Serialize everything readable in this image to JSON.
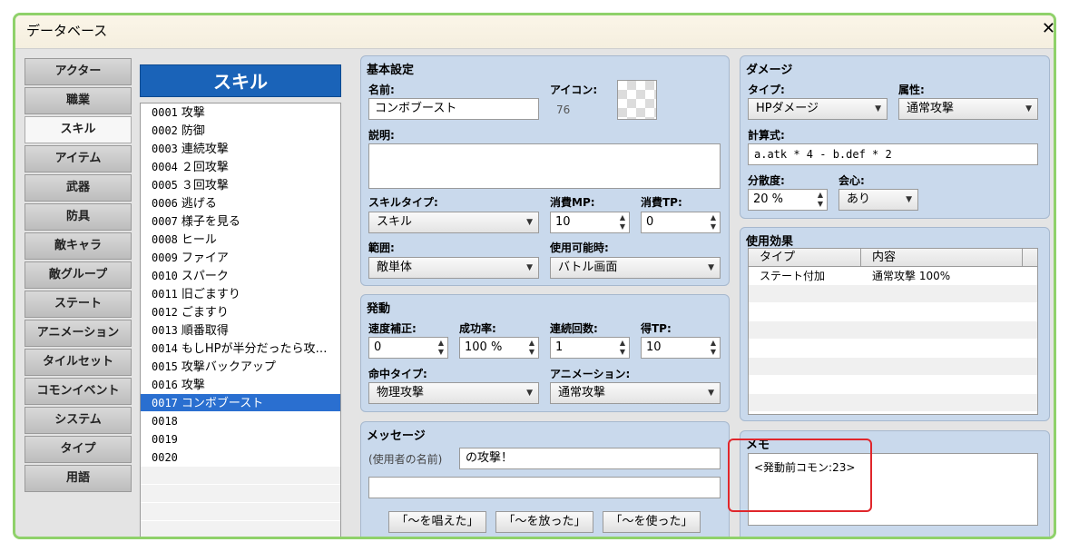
{
  "window": {
    "title": "データベース",
    "close": "✕"
  },
  "categories": [
    "アクター",
    "職業",
    "スキル",
    "アイテム",
    "武器",
    "防具",
    "敵キャラ",
    "敵グループ",
    "ステート",
    "アニメーション",
    "タイルセット",
    "コモンイベント",
    "システム",
    "タイプ",
    "用語"
  ],
  "active_category": "スキル",
  "skill_list": {
    "header": "スキル",
    "items": [
      {
        "num": "0001",
        "name": "攻撃"
      },
      {
        "num": "0002",
        "name": "防御"
      },
      {
        "num": "0003",
        "name": "連続攻撃"
      },
      {
        "num": "0004",
        "name": "２回攻撃"
      },
      {
        "num": "0005",
        "name": "３回攻撃"
      },
      {
        "num": "0006",
        "name": "逃げる"
      },
      {
        "num": "0007",
        "name": "様子を見る"
      },
      {
        "num": "0008",
        "name": "ヒール"
      },
      {
        "num": "0009",
        "name": "ファイア"
      },
      {
        "num": "0010",
        "name": "スパーク"
      },
      {
        "num": "0011",
        "name": "旧ごますり"
      },
      {
        "num": "0012",
        "name": "ごますり"
      },
      {
        "num": "0013",
        "name": "順番取得"
      },
      {
        "num": "0014",
        "name": "もしHPが半分だったら攻…"
      },
      {
        "num": "0015",
        "name": "攻撃バックアップ"
      },
      {
        "num": "0016",
        "name": "攻撃"
      },
      {
        "num": "0017",
        "name": "コンボブースト"
      },
      {
        "num": "0018",
        "name": ""
      },
      {
        "num": "0019",
        "name": ""
      },
      {
        "num": "0020",
        "name": ""
      }
    ],
    "selected": "0017"
  },
  "basic": {
    "title": "基本設定",
    "name_label": "名前:",
    "name_value": "コンボブースト",
    "icon_label": "アイコン:",
    "icon_index": "76",
    "desc_label": "説明:",
    "desc_value": "",
    "skilltype_label": "スキルタイプ:",
    "skilltype_value": "スキル",
    "mp_label": "消費MP:",
    "mp_value": "10",
    "tp_label": "消費TP:",
    "tp_value": "0",
    "scope_label": "範囲:",
    "scope_value": "敵単体",
    "occasion_label": "使用可能時:",
    "occasion_value": "バトル画面"
  },
  "invocation": {
    "title": "発動",
    "speed_label": "速度補正:",
    "speed_value": "0",
    "success_label": "成功率:",
    "success_value": "100 %",
    "repeat_label": "連続回数:",
    "repeat_value": "1",
    "tpgain_label": "得TP:",
    "tpgain_value": "10",
    "hittype_label": "命中タイプ:",
    "hittype_value": "物理攻撃",
    "anim_label": "アニメーション:",
    "anim_value": "通常攻撃"
  },
  "message": {
    "title": "メッセージ",
    "user_label": "(使用者の名前)",
    "line1": "の攻撃！",
    "line2": "",
    "buttons": [
      "「～を唱えた」",
      "「～を放った」",
      "「～を使った」"
    ]
  },
  "damage": {
    "title": "ダメージ",
    "type_label": "タイプ:",
    "type_value": "HPダメージ",
    "element_label": "属性:",
    "element_value": "通常攻撃",
    "formula_label": "計算式:",
    "formula_value": "a.atk * 4 - b.def * 2",
    "variance_label": "分散度:",
    "variance_value": "20 %",
    "critical_label": "会心:",
    "critical_value": "あり"
  },
  "effects": {
    "title": "使用効果",
    "col_type": "タイプ",
    "col_content": "内容",
    "rows": [
      {
        "type": "ステート付加",
        "content": "通常攻撃 100%"
      }
    ]
  },
  "memo": {
    "title": "メモ",
    "value": "<発動前コモン:23>"
  }
}
